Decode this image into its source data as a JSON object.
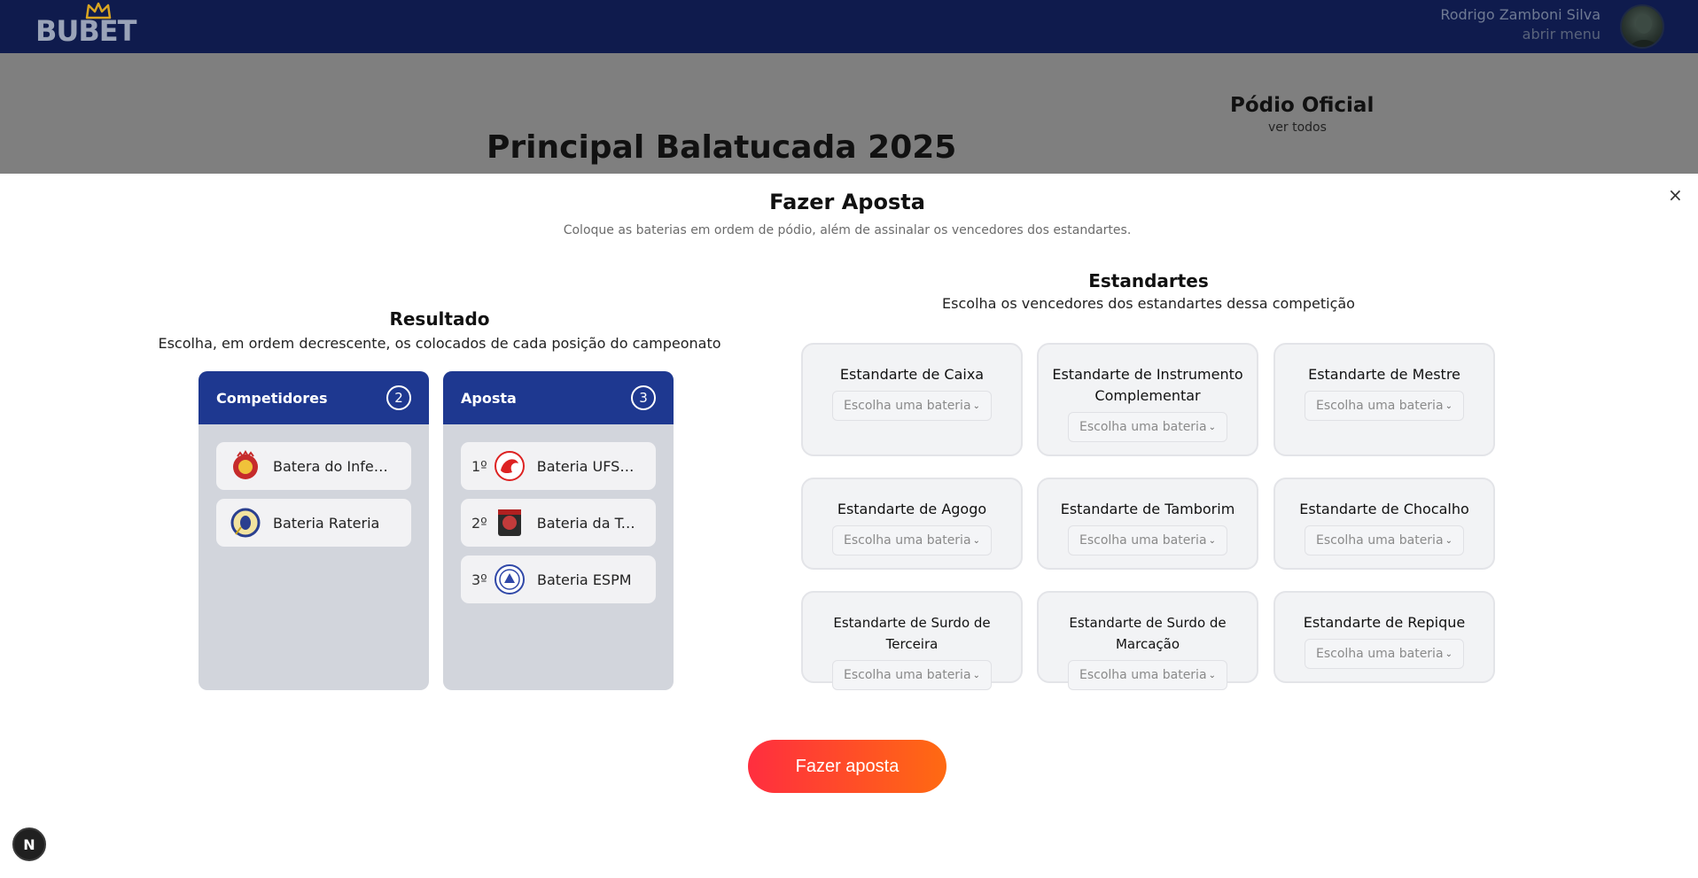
{
  "header": {
    "logo_text": "BUBET",
    "user_name": "Rodrigo Zamboni Silva",
    "menu_link": "abrir menu"
  },
  "background_page": {
    "title": "Principal Balatucada 2025",
    "podium_title": "Pódio Oficial",
    "podium_link": "ver todos"
  },
  "modal": {
    "close_label": "×",
    "title": "Fazer Aposta",
    "subtitle": "Coloque as baterias em ordem de pódio, além de assinalar os vencedores dos estandartes.",
    "result": {
      "title": "Resultado",
      "subtitle": "Escolha, em ordem decrescente, os colocados de cada posição do campeonato",
      "competitors": {
        "label": "Competidores",
        "count": "2",
        "items": [
          {
            "name": "Batera do Inferno"
          },
          {
            "name": "Bateria Rateria"
          }
        ]
      },
      "bet": {
        "label": "Aposta",
        "count": "3",
        "items": [
          {
            "rank": "1º",
            "name": "Bateria UFSCAR"
          },
          {
            "rank": "2º",
            "name": "Bateria da Tourada"
          },
          {
            "rank": "3º",
            "name": "Bateria ESPM"
          }
        ]
      }
    },
    "banners": {
      "title": "Estandartes",
      "subtitle": "Escolha os vencedores dos estandartes dessa competição",
      "placeholder": "Escolha uma bateria",
      "items": [
        {
          "label": "Estandarte de Caixa"
        },
        {
          "label": "Estandarte de Instrumento Complementar"
        },
        {
          "label": "Estandarte de Mestre"
        },
        {
          "label": "Estandarte de Agogo"
        },
        {
          "label": "Estandarte de Tamborim"
        },
        {
          "label": "Estandarte de Chocalho"
        },
        {
          "label": "Estandarte de Surdo de Terceira"
        },
        {
          "label": "Estandarte de Surdo de Marcação"
        },
        {
          "label": "Estandarte de Repique"
        }
      ]
    },
    "submit_label": "Fazer aposta"
  },
  "dev_badge": "N",
  "colors": {
    "header_bg": "#0f1b4d",
    "column_header": "#1e3890",
    "cta_start": "#ff2e3f",
    "cta_end": "#ff6a12"
  }
}
